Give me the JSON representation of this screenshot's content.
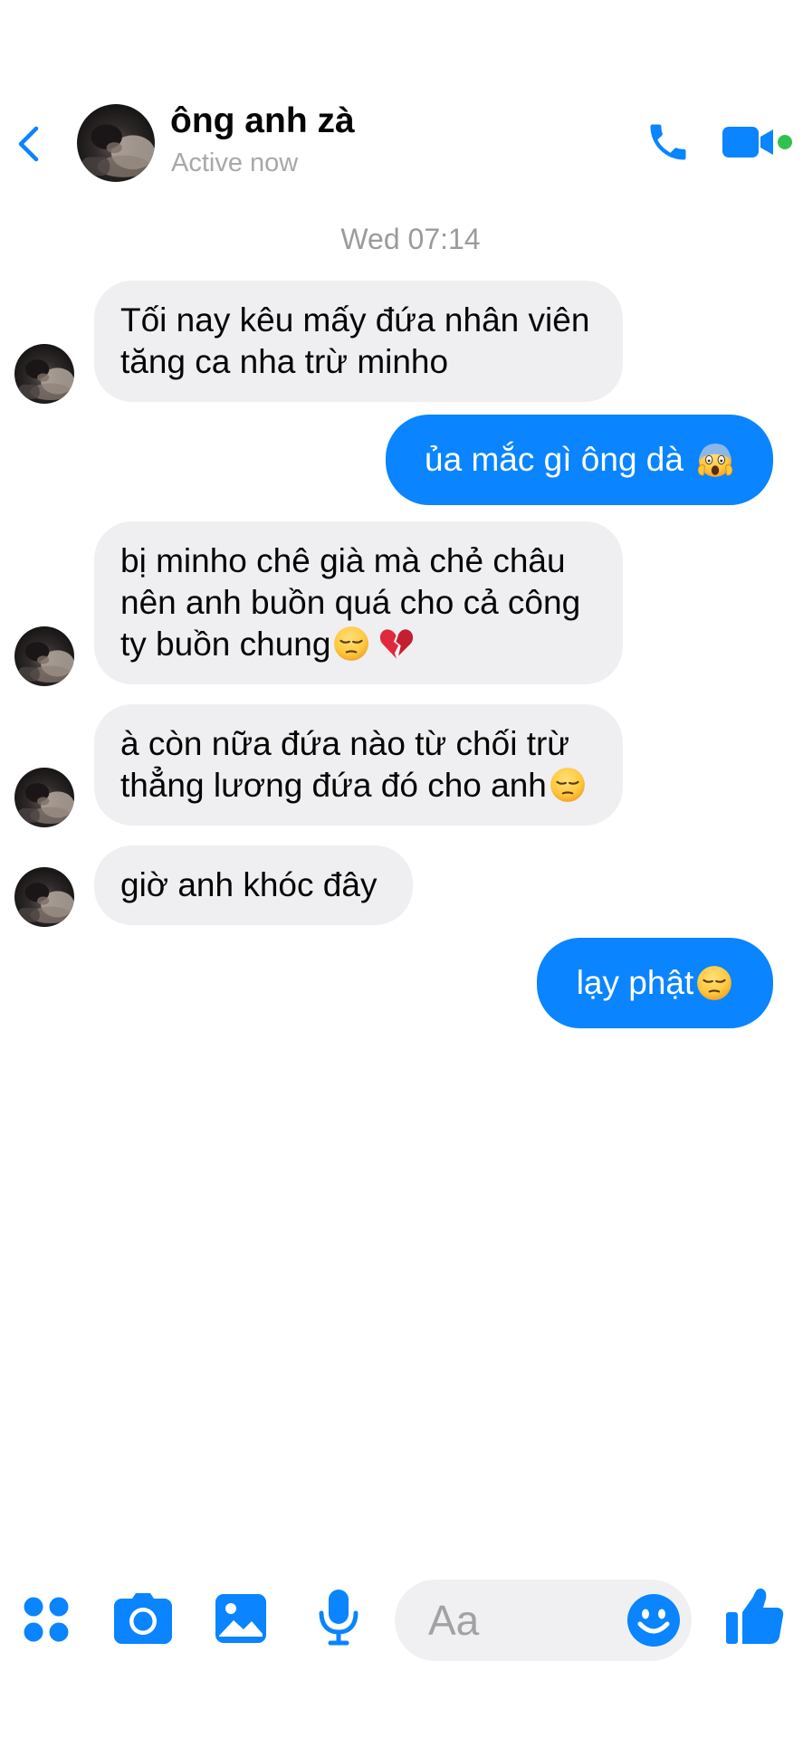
{
  "header": {
    "back_icon": "chevron-left-icon",
    "contact_name": "ông anh zà",
    "status": "Active now",
    "call_icon": "phone-icon",
    "video_icon": "video-camera-icon",
    "active_indicator_color": "#31c24d"
  },
  "conversation": {
    "timestamp": "Wed 07:14",
    "messages": [
      {
        "direction": "incoming",
        "lines": [
          "Tối nay kêu mấy đứa nhân viên",
          "tăng ca nha trừ minho"
        ],
        "emojis": []
      },
      {
        "direction": "outgoing",
        "lines": [
          "ủa mắc gì ông dà"
        ],
        "emojis": [
          "face-screaming-in-fear"
        ]
      },
      {
        "direction": "incoming",
        "lines": [
          "bị minho chê già mà chẻ châu",
          "nên anh buồn quá cho cả công",
          "ty buồn chung"
        ],
        "emojis": [
          "pensive-face",
          "broken-heart"
        ]
      },
      {
        "direction": "incoming",
        "lines": [
          "à còn nữa đứa nào từ chối trừ",
          "thẳng lương đứa đó cho anh"
        ],
        "emojis": [
          "pensive-face"
        ]
      },
      {
        "direction": "incoming",
        "lines": [
          "giờ anh khóc đây"
        ],
        "emojis": []
      },
      {
        "direction": "outgoing",
        "lines": [
          "lạy phật"
        ],
        "emojis": [
          "pensive-face"
        ]
      }
    ]
  },
  "composer": {
    "apps_icon": "four-dots-icon",
    "camera_icon": "camera-icon",
    "gallery_icon": "photo-gallery-icon",
    "mic_icon": "microphone-icon",
    "input_placeholder": "Aa",
    "emoji_icon": "smiley-face-icon",
    "like_icon": "thumbs-up-icon"
  },
  "colors": {
    "accent": "#0a84ff",
    "incoming_bubble": "#efeff1",
    "outgoing_bubble": "#0a84ff",
    "secondary_text": "#a8a8a8"
  }
}
